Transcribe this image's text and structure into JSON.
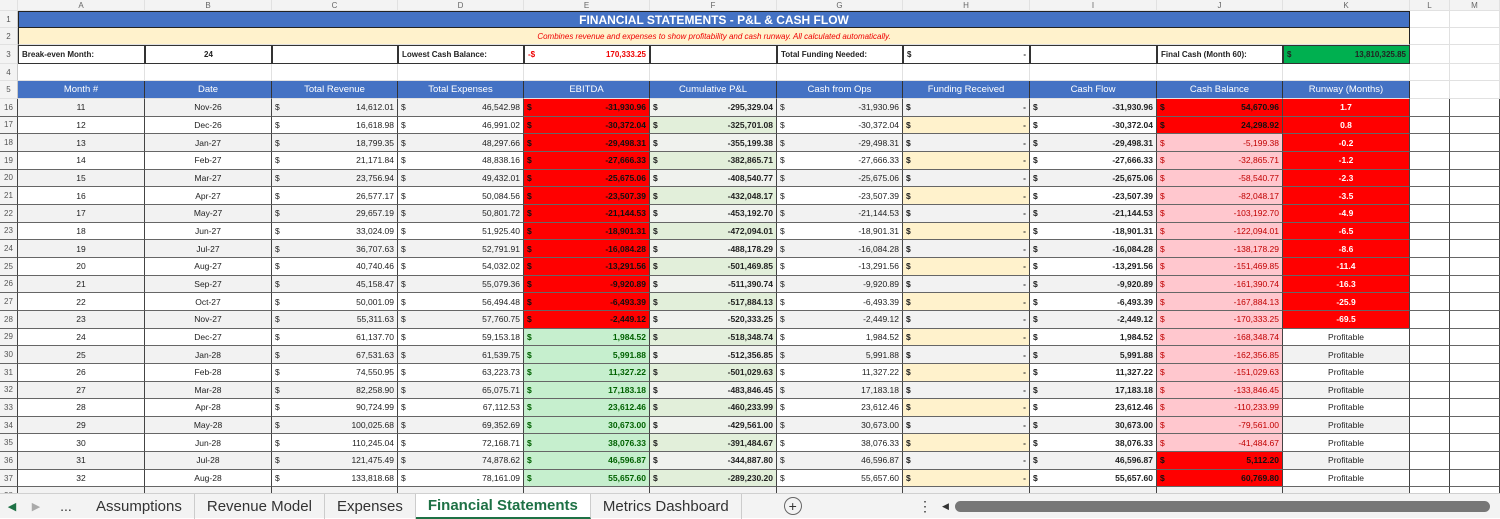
{
  "columns": [
    "A",
    "B",
    "C",
    "D",
    "E",
    "F",
    "G",
    "H",
    "I",
    "J",
    "K",
    "L",
    "M"
  ],
  "title": "FINANCIAL STATEMENTS - P&L & CASH FLOW",
  "subtitle": "Combines revenue and expenses to show profitability and cash runway. All calculated automatically.",
  "summary": {
    "breakeven_label": "Break-even Month:",
    "breakeven_value": "24",
    "lowest_cash_label": "Lowest Cash Balance:",
    "lowest_cash_sign": "-$",
    "lowest_cash_value": "170,333.25",
    "funding_label": "Total Funding Needed:",
    "funding_sign": "$",
    "funding_value": "-",
    "final_cash_label": "Final Cash (Month 60):",
    "final_cash_sign": "$",
    "final_cash_value": "13,810,325.85"
  },
  "headers": [
    "Month #",
    "Date",
    "Total Revenue",
    "Total Expenses",
    "EBITDA",
    "Cumulative P&L",
    "Cash from Ops",
    "Funding Received",
    "Cash Flow",
    "Cash Balance",
    "Runway (Months)"
  ],
  "row_numbers": [
    1,
    2,
    3,
    4,
    5,
    16,
    17,
    18,
    19,
    20,
    21,
    22,
    23,
    24,
    25,
    26,
    27,
    28,
    29,
    30,
    31,
    32,
    33,
    34,
    35,
    36,
    37,
    38
  ],
  "rows": [
    [
      "11",
      "Nov-26",
      "14,612.01",
      "46,542.98",
      "-31,930.96",
      "-295,329.04",
      "-31,930.96",
      "-",
      "-31,930.96",
      "54,670.96",
      "1.7"
    ],
    [
      "12",
      "Dec-26",
      "16,618.98",
      "46,991.02",
      "-30,372.04",
      "-325,701.08",
      "-30,372.04",
      "-",
      "-30,372.04",
      "24,298.92",
      "0.8"
    ],
    [
      "13",
      "Jan-27",
      "18,799.35",
      "48,297.66",
      "-29,498.31",
      "-355,199.38",
      "-29,498.31",
      "-",
      "-29,498.31",
      "-5,199.38",
      "-0.2"
    ],
    [
      "14",
      "Feb-27",
      "21,171.84",
      "48,838.16",
      "-27,666.33",
      "-382,865.71",
      "-27,666.33",
      "-",
      "-27,666.33",
      "-32,865.71",
      "-1.2"
    ],
    [
      "15",
      "Mar-27",
      "23,756.94",
      "49,432.01",
      "-25,675.06",
      "-408,540.77",
      "-25,675.06",
      "-",
      "-25,675.06",
      "-58,540.77",
      "-2.3"
    ],
    [
      "16",
      "Apr-27",
      "26,577.17",
      "50,084.56",
      "-23,507.39",
      "-432,048.17",
      "-23,507.39",
      "-",
      "-23,507.39",
      "-82,048.17",
      "-3.5"
    ],
    [
      "17",
      "May-27",
      "29,657.19",
      "50,801.72",
      "-21,144.53",
      "-453,192.70",
      "-21,144.53",
      "-",
      "-21,144.53",
      "-103,192.70",
      "-4.9"
    ],
    [
      "18",
      "Jun-27",
      "33,024.09",
      "51,925.40",
      "-18,901.31",
      "-472,094.01",
      "-18,901.31",
      "-",
      "-18,901.31",
      "-122,094.01",
      "-6.5"
    ],
    [
      "19",
      "Jul-27",
      "36,707.63",
      "52,791.91",
      "-16,084.28",
      "-488,178.29",
      "-16,084.28",
      "-",
      "-16,084.28",
      "-138,178.29",
      "-8.6"
    ],
    [
      "20",
      "Aug-27",
      "40,740.46",
      "54,032.02",
      "-13,291.56",
      "-501,469.85",
      "-13,291.56",
      "-",
      "-13,291.56",
      "-151,469.85",
      "-11.4"
    ],
    [
      "21",
      "Sep-27",
      "45,158.47",
      "55,079.36",
      "-9,920.89",
      "-511,390.74",
      "-9,920.89",
      "-",
      "-9,920.89",
      "-161,390.74",
      "-16.3"
    ],
    [
      "22",
      "Oct-27",
      "50,001.09",
      "56,494.48",
      "-6,493.39",
      "-517,884.13",
      "-6,493.39",
      "-",
      "-6,493.39",
      "-167,884.13",
      "-25.9"
    ],
    [
      "23",
      "Nov-27",
      "55,311.63",
      "57,760.75",
      "-2,449.12",
      "-520,333.25",
      "-2,449.12",
      "-",
      "-2,449.12",
      "-170,333.25",
      "-69.5"
    ],
    [
      "24",
      "Dec-27",
      "61,137.70",
      "59,153.18",
      "1,984.52",
      "-518,348.74",
      "1,984.52",
      "-",
      "1,984.52",
      "-168,348.74",
      "Profitable"
    ],
    [
      "25",
      "Jan-28",
      "67,531.63",
      "61,539.75",
      "5,991.88",
      "-512,356.85",
      "5,991.88",
      "-",
      "5,991.88",
      "-162,356.85",
      "Profitable"
    ],
    [
      "26",
      "Feb-28",
      "74,550.95",
      "63,223.73",
      "11,327.22",
      "-501,029.63",
      "11,327.22",
      "-",
      "11,327.22",
      "-151,029.63",
      "Profitable"
    ],
    [
      "27",
      "Mar-28",
      "82,258.90",
      "65,075.71",
      "17,183.18",
      "-483,846.45",
      "17,183.18",
      "-",
      "17,183.18",
      "-133,846.45",
      "Profitable"
    ],
    [
      "28",
      "Apr-28",
      "90,724.99",
      "67,112.53",
      "23,612.46",
      "-460,233.99",
      "23,612.46",
      "-",
      "23,612.46",
      "-110,233.99",
      "Profitable"
    ],
    [
      "29",
      "May-28",
      "100,025.68",
      "69,352.69",
      "30,673.00",
      "-429,561.00",
      "30,673.00",
      "-",
      "30,673.00",
      "-79,561.00",
      "Profitable"
    ],
    [
      "30",
      "Jun-28",
      "110,245.04",
      "72,168.71",
      "38,076.33",
      "-391,484.67",
      "38,076.33",
      "-",
      "38,076.33",
      "-41,484.67",
      "Profitable"
    ],
    [
      "31",
      "Jul-28",
      "121,475.49",
      "74,878.62",
      "46,596.87",
      "-344,887.80",
      "46,596.87",
      "-",
      "46,596.87",
      "5,112.20",
      "Profitable"
    ],
    [
      "32",
      "Aug-28",
      "133,818.68",
      "78,161.09",
      "55,657.60",
      "-289,230.20",
      "55,657.60",
      "-",
      "55,657.60",
      "60,769.80",
      "Profitable"
    ]
  ],
  "tabs": [
    "Assumptions",
    "Revenue Model",
    "Expenses",
    "Financial Statements",
    "Metrics Dashboard"
  ],
  "active_tab": "Financial Statements",
  "tab_more": "...",
  "colors": {
    "header_blue": "#4472c4",
    "negative_red": "#ff0000",
    "positive_green": "#c6efce",
    "final_cash_green": "#00b050",
    "note_yellow": "#fff2cc"
  }
}
